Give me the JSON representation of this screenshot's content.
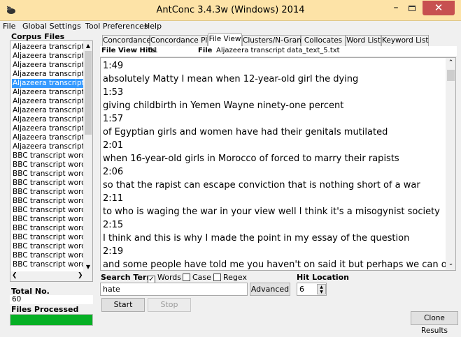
{
  "window": {
    "title": "AntConc 3.4.3w (Windows) 2014"
  },
  "menu": [
    "File",
    "Global Settings",
    "Tool Preferences",
    "Help"
  ],
  "sidebar": {
    "label": "Corpus Files",
    "files": [
      "Aljazeera transcript",
      "Aljazeera transcript",
      "Aljazeera transcript",
      "Aljazeera transcript",
      "Aljazeera transcript",
      "Aljazeera transcript",
      "Aljazeera transcript",
      "Aljazeera transcript",
      "Aljazeera transcript",
      "Aljazeera transcript",
      "Aljazeera transcript",
      "Aljazeera transcript",
      "BBC transcript worc",
      "BBC transcript worc",
      "BBC transcript worc",
      "BBC transcript worc",
      "BBC transcript worc",
      "BBC transcript worc",
      "BBC transcript worc",
      "BBC transcript worc",
      "BBC transcript worc",
      "BBC transcript worc",
      "BBC transcript worc",
      "BBC transcript worc",
      "BBC transcript worc"
    ],
    "selected_index": 4,
    "total_label": "Total No.",
    "total_value": "60",
    "processed_label": "Files Processed",
    "processed_fraction": 1.0
  },
  "tabs": [
    "Concordance",
    "Concordance Plot",
    "File View",
    "Clusters/N-Grams",
    "Collocates",
    "Word List",
    "Keyword List"
  ],
  "active_tab": 2,
  "file_view": {
    "hits_label": "File View Hits",
    "hits_value": "11",
    "file_label": "File",
    "file_value": "Aljazeera transcript data_text_5.txt",
    "lines": [
      "1:49",
      "absolutely Matty I mean when 12-year-old girl the dying",
      "1:53",
      "giving childbirth in Yemen Wayne ninety-one percent",
      "1:57",
      "of Egyptian girls and women have had their genitals mutilated",
      "2:01",
      "when 16-year-old girls in Morocco of forced to marry their rapists",
      "2:06",
      "so that the rapist can escape conviction that is nothing short of a war",
      "2:11",
      "to who is waging the war in your view well I think it's a misogynist society",
      "2:15",
      "I think and this is why I made the point in my essay of the question",
      "2:19",
      "and some people have told me you haven't on said it but perhaps we can on to it"
    ]
  },
  "search": {
    "label": "Search Term",
    "words_label": "Words",
    "words_checked": true,
    "case_label": "Case",
    "case_checked": false,
    "regex_label": "Regex",
    "regex_checked": false,
    "value": "hate",
    "advanced_label": "Advanced",
    "hit_location_label": "Hit Location",
    "hit_location_value": "6",
    "start_label": "Start",
    "stop_label": "Stop",
    "clone_label": "Clone Results"
  }
}
